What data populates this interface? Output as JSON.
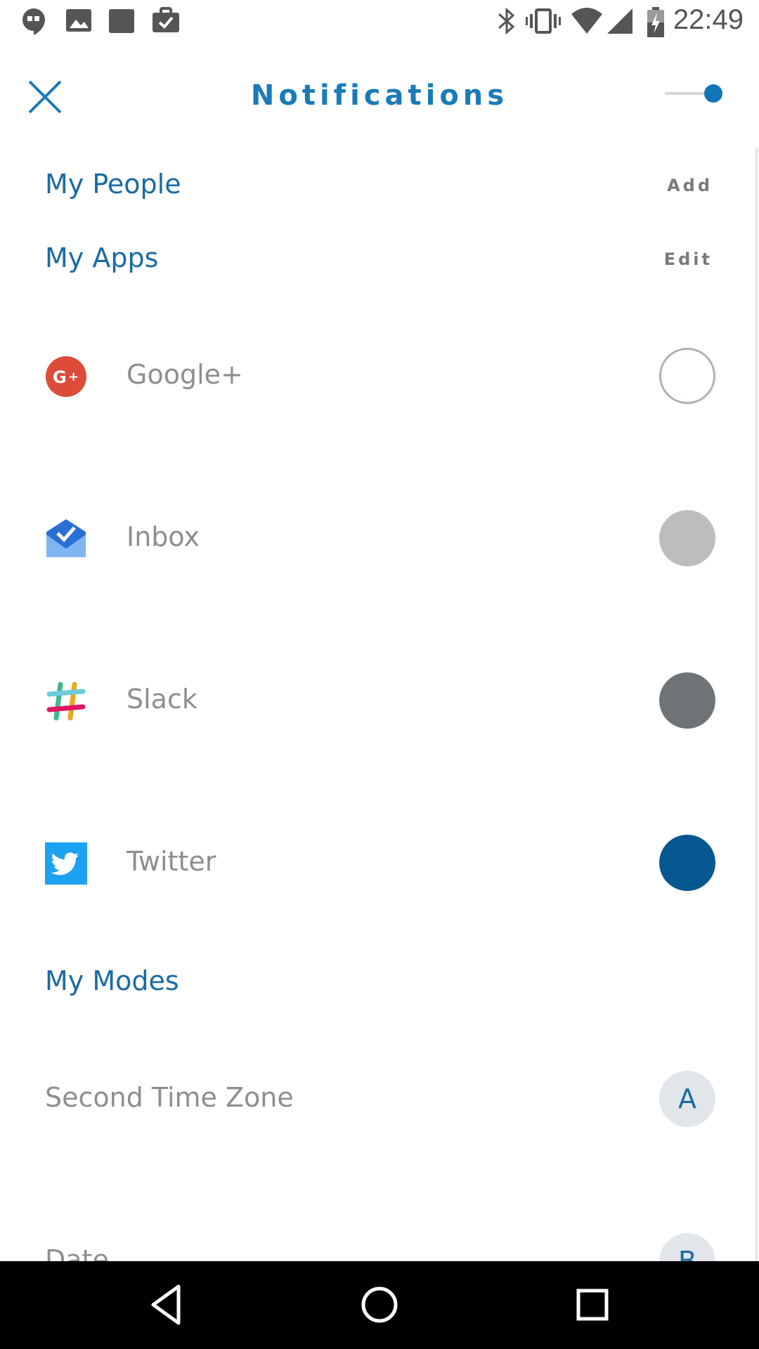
{
  "status_bar": {
    "time": "22:49",
    "left_icons": [
      "hangouts-icon",
      "image-icon",
      "square-app-icon",
      "briefcase-check-icon"
    ],
    "right_icons": [
      "bluetooth-icon",
      "vibrate-icon",
      "wifi-icon",
      "cell-signal-icon",
      "battery-charging-icon"
    ]
  },
  "header": {
    "title": "Notifications",
    "toggle_on": true,
    "accent_color": "#1176b8"
  },
  "sections": {
    "people": {
      "label": "My People",
      "action": "Add"
    },
    "apps": {
      "label": "My Apps",
      "action": "Edit"
    },
    "modes": {
      "label": "My Modes"
    }
  },
  "apps": [
    {
      "name": "Google+",
      "icon": "google-plus-icon",
      "circle_color": "#ffffff",
      "circle_style": "outline"
    },
    {
      "name": "Inbox",
      "icon": "inbox-icon",
      "circle_color": "#bdbdbd",
      "circle_style": "filled"
    },
    {
      "name": "Slack",
      "icon": "slack-icon",
      "circle_color": "#707376",
      "circle_style": "filled"
    },
    {
      "name": "Twitter",
      "icon": "twitter-icon",
      "circle_color": "#05578f",
      "circle_style": "filled"
    }
  ],
  "modes": [
    {
      "label": "Second Time Zone",
      "badge": "A"
    },
    {
      "label": "Date",
      "badge": "B"
    }
  ],
  "nav_bar": {
    "buttons": [
      "back-icon",
      "home-icon",
      "recents-icon"
    ]
  }
}
